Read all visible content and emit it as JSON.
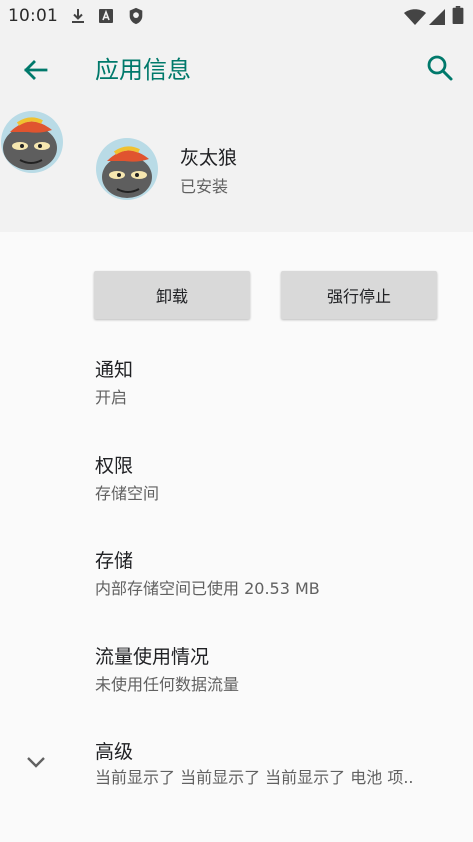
{
  "status_bar": {
    "time": "10:01",
    "icons": [
      "download-icon",
      "a-notification-icon",
      "shield-icon",
      "wifi-icon",
      "cellular-icon",
      "battery-icon"
    ]
  },
  "app_bar": {
    "title": "应用信息",
    "back_icon": "arrow-back-icon",
    "search_icon": "search-icon",
    "accent_color": "#00796b"
  },
  "app_header": {
    "name": "灰太狼",
    "status": "已安装",
    "icon": "wolf-avatar-icon"
  },
  "buttons": {
    "uninstall": "卸载",
    "force_stop": "强行停止"
  },
  "preferences": [
    {
      "title": "通知",
      "summary": "开启"
    },
    {
      "title": "权限",
      "summary": "存储空间"
    },
    {
      "title": "存储",
      "summary": "内部存储空间已使用 20.53 MB"
    },
    {
      "title": "流量使用情况",
      "summary": "未使用任何数据流量"
    },
    {
      "title": "高级",
      "summary": "当前显示了 当前显示了 当前显示了 电池 项.."
    }
  ]
}
